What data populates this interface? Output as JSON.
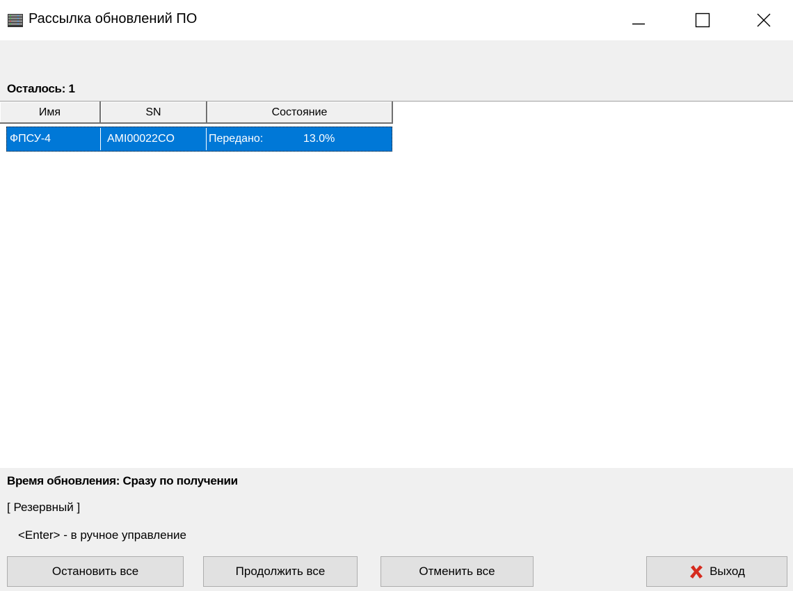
{
  "window": {
    "title": "Рассылка обновлений ПО",
    "app_icon": "server-rack-icon",
    "controls": [
      "minimize-icon",
      "maximize-icon",
      "close-icon"
    ]
  },
  "remaining": "Осталось: 1",
  "table": {
    "columns": [
      "Имя",
      "SN",
      "Состояние"
    ],
    "rows": [
      {
        "name": "ФПСУ-4",
        "sn": "AMI00022CO",
        "state_label": "Передано:",
        "state_value": "13.0%",
        "selected": true
      }
    ]
  },
  "update_time": "Время обновления:  Сразу по получении",
  "mode": "[ Резервный ]",
  "hint": "<Enter> - в ручное управление",
  "buttons": {
    "stop_all": "Остановить все",
    "continue_all": "Продолжить все",
    "cancel_all": "Отменить все",
    "exit": "Выход",
    "exit_icon": "red-x-icon"
  },
  "colors": {
    "selection": "#0078d7",
    "form_bg": "#f0f0f0",
    "exit_icon": "#d52b1e"
  }
}
